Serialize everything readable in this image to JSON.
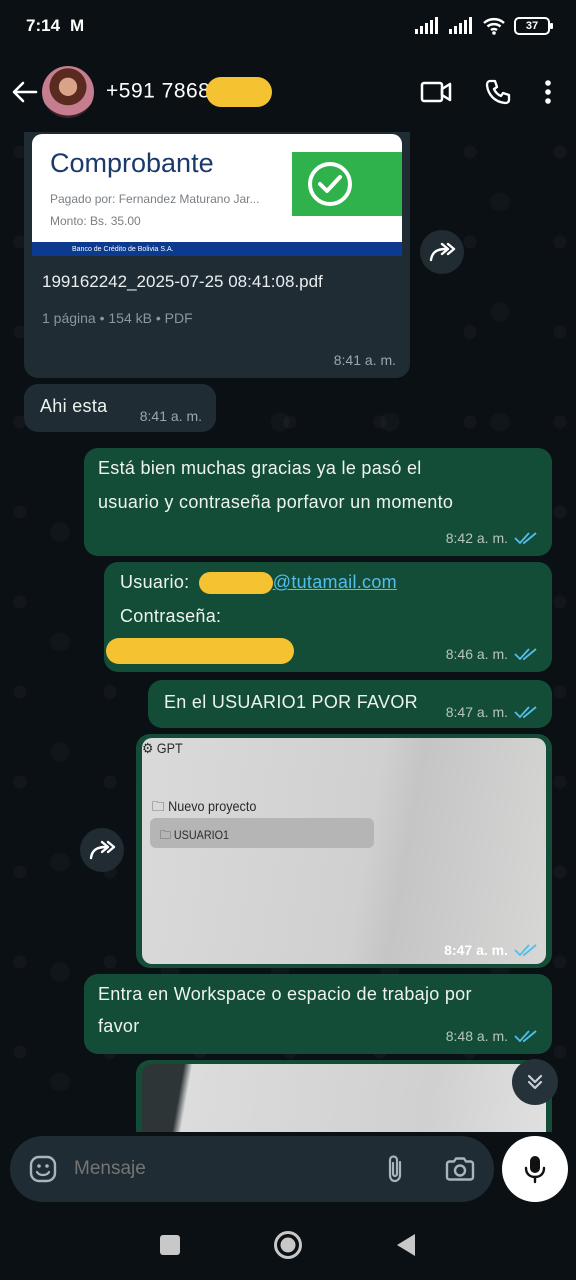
{
  "status": {
    "time": "7:14",
    "notif_icon": "M",
    "battery": "37"
  },
  "header": {
    "contact": "+591 7868"
  },
  "messages": {
    "doc": {
      "thumb_title": "Comprobante",
      "thumb_payer": "Pagado por: Fernandez Maturano Jar...",
      "thumb_amount": "Monto: Bs. 35.00",
      "thumb_bank": "Banco de Crédito de Bolivia S.A.",
      "filename": "199162242_2025-07-25 08:41:08.pdf",
      "meta": "1 página • 154 kB • PDF",
      "time": "8:41 a. m."
    },
    "ahi": {
      "text": "Ahi esta",
      "time": "8:41 a. m."
    },
    "esta_bien": {
      "line1": "Está bien muchas gracias ya le pasó el",
      "line2": "usuario y contraseña porfavor un momento",
      "time": "8:42 a. m."
    },
    "creds": {
      "user_label": "Usuario:",
      "user_domain": "@tutamail.com",
      "pass_label": "Contraseña:",
      "time": "8:46 a. m."
    },
    "usuario1": {
      "text": "En el USUARIO1 POR FAVOR",
      "time": "8:47 a. m."
    },
    "photo1": {
      "gpt": "GPT",
      "nuevo": "Nuevo proyecto",
      "usuario": "USUARIO1",
      "time": "8:47 a. m."
    },
    "workspace": {
      "line1": "Entra en Workspace o espacio de trabajo por",
      "line2": "favor",
      "time": "8:48 a. m."
    }
  },
  "composer": {
    "placeholder": "Mensaje"
  },
  "colors": {
    "outgoing": "#134d37",
    "incoming": "#1f2c34",
    "redaction": "#f5c232",
    "ticks": "#53bdeb"
  }
}
